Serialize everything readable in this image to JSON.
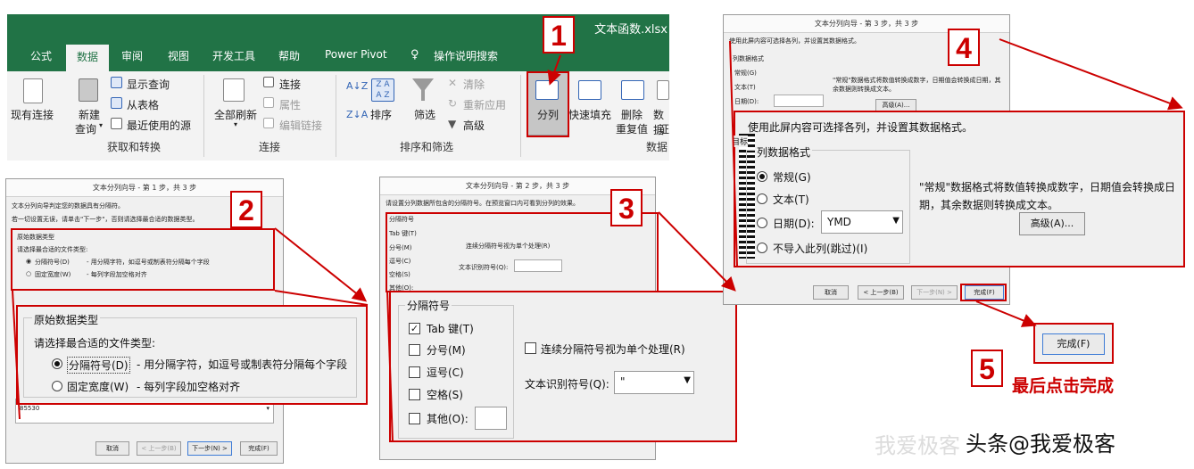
{
  "ribbon": {
    "file_title": "文本函数.xlsx",
    "tabs": [
      "公式",
      "数据",
      "审阅",
      "视图",
      "开发工具",
      "帮助",
      "Power Pivot",
      "操作说明搜索"
    ],
    "get_data_group": {
      "existing_connections": "现有连接",
      "new_query": "新建",
      "new_query_2": "查询",
      "show_queries": "显示查询",
      "from_table": "从表格",
      "recent_sources": "最近使用的源",
      "label": "获取和转换"
    },
    "connections_group": {
      "refresh_all": "全部刷新",
      "connections": "连接",
      "properties": "属性",
      "edit_links": "编辑链接",
      "label": "连接"
    },
    "sort_filter_group": {
      "sort": "排序",
      "filter": "筛选",
      "clear": "清除",
      "reapply": "重新应用",
      "advanced": "高级",
      "label": "排序和筛选"
    },
    "data_tools_group": {
      "text_to_columns": "分列",
      "flash_fill": "快速填充",
      "remove_dup": "删除",
      "remove_dup_2": "重复值",
      "validation": "数据",
      "validation_2": "证",
      "label": "数据"
    }
  },
  "step1": {
    "title": "文本分列向导 - 第 1 步，共 3 步",
    "line1": "文本分列向导判定您的数据具有分隔符。",
    "line2": "若一切设置无误，请单击\"下一步\"，否则请选择最合适的数据类型。",
    "group_label": "原始数据类型",
    "prompt": "请选择最合适的文件类型:",
    "opt_delimited": "分隔符号(D)",
    "opt_delimited_desc": "- 用分隔字符，如逗号或制表符分隔每个字段",
    "opt_fixed": "固定宽度(W)",
    "opt_fixed_desc": "- 每列字段加空格对齐",
    "preview_value": "85530",
    "btn_cancel": "取消",
    "btn_prev": "< 上一步(B)",
    "btn_next": "下一步(N) >",
    "btn_finish": "完成(F)"
  },
  "step2": {
    "title": "文本分列向导 - 第 2 步，共 3 步",
    "line1": "请设置分列数据所包含的分隔符号。在预览窗口内可看到分列的效果。",
    "group_label": "分隔符号",
    "tab": "Tab 键(T)",
    "semicolon": "分号(M)",
    "comma": "逗号(C)",
    "space": "空格(S)",
    "other": "其他(O):",
    "consecutive": "连续分隔符号视为单个处理(R)",
    "qualifier_label": "文本识别符号(Q):",
    "qualifier_value": "\""
  },
  "step3": {
    "title": "文本分列向导 - 第 3 步，共 3 步",
    "line1": "使用此屏内容可选择各列，并设置其数据格式。",
    "group_label": "列数据格式",
    "general": "常规(G)",
    "text": "文本(T)",
    "date": "日期(D):",
    "date_value": "YMD",
    "skip": "不导入此列(跳过)(I)",
    "note": "\"常规\"数据格式将数值转换成数字，日期值会转换成日期，其余数据则转换成文本。",
    "advanced": "高级(A)...",
    "target": "目标",
    "btn_cancel": "取消",
    "btn_prev": "< 上一步(B)",
    "btn_next": "下一步(N) >",
    "btn_finish": "完成(F)"
  },
  "callouts": {
    "n1": "1",
    "n2": "2",
    "n3": "3",
    "n4": "4",
    "n5": "5",
    "finish_button": "完成(F)",
    "finish_caption": "最后点击完成"
  },
  "watermark": "头条@我爱极客",
  "watermark_ghost": "我爱极客",
  "colors": {
    "accent_red": "#cc0000",
    "excel_green": "#217346"
  }
}
